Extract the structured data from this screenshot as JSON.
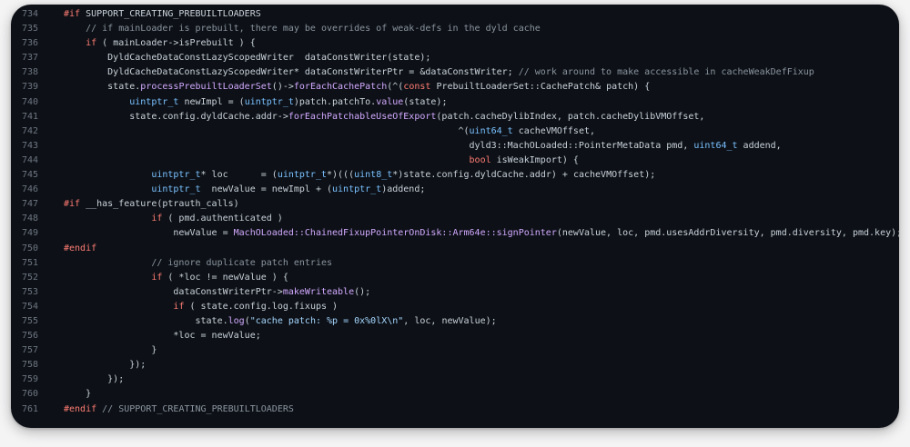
{
  "code_lines": [
    {
      "n": "734",
      "tokens": [
        [
          "k",
          "#if"
        ],
        [
          "p",
          " SUPPORT_CREATING_PREBUILTLOADERS"
        ]
      ]
    },
    {
      "n": "735",
      "tokens": [
        [
          "p",
          "    "
        ],
        [
          "c",
          "// if mainLoader is prebuilt, there may be overrides of weak-defs in the dyld cache"
        ]
      ]
    },
    {
      "n": "736",
      "tokens": [
        [
          "p",
          "    "
        ],
        [
          "k",
          "if"
        ],
        [
          "p",
          " ( mainLoader->isPrebuilt ) {"
        ]
      ]
    },
    {
      "n": "737",
      "tokens": [
        [
          "p",
          "        DyldCacheDataConstLazyScopedWriter  dataConstWriter(state);"
        ]
      ]
    },
    {
      "n": "738",
      "tokens": [
        [
          "p",
          "        DyldCacheDataConstLazyScopedWriter* dataConstWriterPtr = &dataConstWriter; "
        ],
        [
          "c",
          "// work around to make accessible in cacheWeakDefFixup"
        ]
      ]
    },
    {
      "n": "739",
      "tokens": [
        [
          "p",
          "        state."
        ],
        [
          "f",
          "processPrebuiltLoaderSet"
        ],
        [
          "p",
          "()->"
        ],
        [
          "f",
          "forEachCachePatch"
        ],
        [
          "p",
          "(^("
        ],
        [
          "k",
          "const"
        ],
        [
          "p",
          " PrebuiltLoaderSet::CachePatch& patch) {"
        ]
      ]
    },
    {
      "n": "740",
      "tokens": [
        [
          "p",
          "            "
        ],
        [
          "t",
          "uintptr_t"
        ],
        [
          "p",
          " newImpl = ("
        ],
        [
          "t",
          "uintptr_t"
        ],
        [
          "p",
          ")patch.patchTo."
        ],
        [
          "f",
          "value"
        ],
        [
          "p",
          "(state);"
        ]
      ]
    },
    {
      "n": "741",
      "tokens": [
        [
          "p",
          "            state.config.dyldCache.addr->"
        ],
        [
          "f",
          "forEachPatchableUseOfExport"
        ],
        [
          "p",
          "(patch.cacheDylibIndex, patch.cacheDylibVMOffset,"
        ]
      ]
    },
    {
      "n": "742",
      "tokens": [
        [
          "p",
          "                                                                        ^("
        ],
        [
          "t",
          "uint64_t"
        ],
        [
          "p",
          " cacheVMOffset,"
        ]
      ]
    },
    {
      "n": "743",
      "tokens": [
        [
          "p",
          "                                                                          dyld3::MachOLoaded::PointerMetaData pmd, "
        ],
        [
          "t",
          "uint64_t"
        ],
        [
          "p",
          " addend,"
        ]
      ]
    },
    {
      "n": "744",
      "tokens": [
        [
          "p",
          "                                                                          "
        ],
        [
          "k",
          "bool"
        ],
        [
          "p",
          " isWeakImport) {"
        ]
      ]
    },
    {
      "n": "745",
      "tokens": [
        [
          "p",
          "                "
        ],
        [
          "t",
          "uintptr_t"
        ],
        [
          "p",
          "* loc      = ("
        ],
        [
          "t",
          "uintptr_t"
        ],
        [
          "p",
          "*)((("
        ],
        [
          "t",
          "uint8_t"
        ],
        [
          "p",
          "*)state.config.dyldCache.addr) + cacheVMOffset);"
        ]
      ]
    },
    {
      "n": "746",
      "tokens": [
        [
          "p",
          "                "
        ],
        [
          "t",
          "uintptr_t"
        ],
        [
          "p",
          "  newValue = newImpl + ("
        ],
        [
          "t",
          "uintptr_t"
        ],
        [
          "p",
          ")addend;"
        ]
      ]
    },
    {
      "n": "747",
      "tokens": [
        [
          "k",
          "#if"
        ],
        [
          "p",
          " __has_feature(ptrauth_calls)"
        ]
      ]
    },
    {
      "n": "748",
      "tokens": [
        [
          "p",
          "                "
        ],
        [
          "k",
          "if"
        ],
        [
          "p",
          " ( pmd.authenticated )"
        ]
      ]
    },
    {
      "n": "749",
      "tokens": [
        [
          "p",
          "                    newValue = "
        ],
        [
          "f",
          "MachOLoaded::ChainedFixupPointerOnDisk::Arm64e::signPointer"
        ],
        [
          "p",
          "(newValue, loc, pmd.usesAddrDiversity, pmd.diversity, pmd.key);"
        ]
      ]
    },
    {
      "n": "750",
      "tokens": [
        [
          "k",
          "#endif"
        ]
      ]
    },
    {
      "n": "751",
      "tokens": [
        [
          "p",
          "                "
        ],
        [
          "c",
          "// ignore duplicate patch entries"
        ]
      ]
    },
    {
      "n": "752",
      "tokens": [
        [
          "p",
          "                "
        ],
        [
          "k",
          "if"
        ],
        [
          "p",
          " ( *loc != newValue ) {"
        ]
      ]
    },
    {
      "n": "753",
      "tokens": [
        [
          "p",
          "                    dataConstWriterPtr->"
        ],
        [
          "f",
          "makeWriteable"
        ],
        [
          "p",
          "();"
        ]
      ]
    },
    {
      "n": "754",
      "tokens": [
        [
          "p",
          "                    "
        ],
        [
          "k",
          "if"
        ],
        [
          "p",
          " ( state.config.log.fixups )"
        ]
      ]
    },
    {
      "n": "755",
      "tokens": [
        [
          "p",
          "                        state."
        ],
        [
          "f",
          "log"
        ],
        [
          "p",
          "("
        ],
        [
          "s",
          "\"cache patch: %p = 0x%0lX\\n\""
        ],
        [
          "p",
          ", loc, newValue);"
        ]
      ]
    },
    {
      "n": "756",
      "tokens": [
        [
          "p",
          "                    *loc = newValue;"
        ]
      ]
    },
    {
      "n": "757",
      "tokens": [
        [
          "p",
          "                }"
        ]
      ]
    },
    {
      "n": "758",
      "tokens": [
        [
          "p",
          "            });"
        ]
      ]
    },
    {
      "n": "759",
      "tokens": [
        [
          "p",
          "        });"
        ]
      ]
    },
    {
      "n": "760",
      "tokens": [
        [
          "p",
          "    }"
        ]
      ]
    },
    {
      "n": "761",
      "tokens": [
        [
          "k",
          "#endif"
        ],
        [
          "p",
          " "
        ],
        [
          "c",
          "// SUPPORT_CREATING_PREBUILTLOADERS"
        ]
      ]
    }
  ]
}
